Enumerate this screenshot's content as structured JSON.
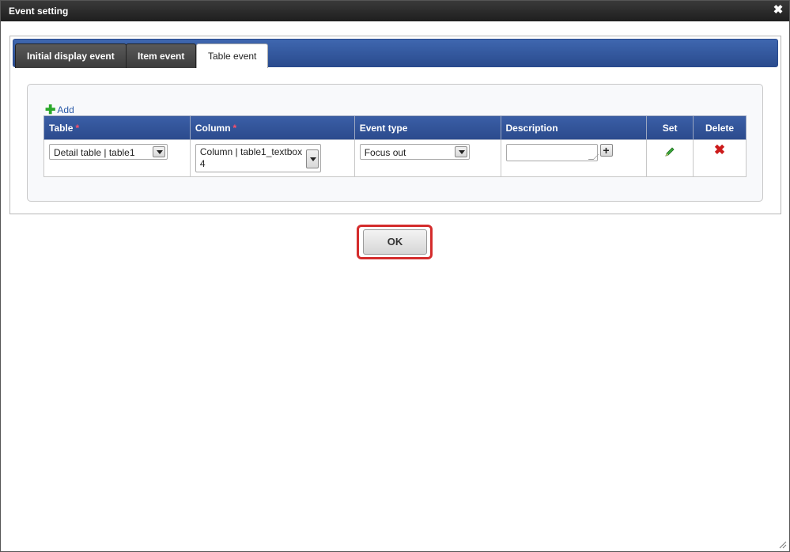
{
  "dialog": {
    "title": "Event setting",
    "close_icon": "close-icon"
  },
  "tabs": [
    {
      "label": "Initial display event",
      "active": false
    },
    {
      "label": "Item event",
      "active": false
    },
    {
      "label": "Table event",
      "active": true
    }
  ],
  "add_link": {
    "label": "Add",
    "icon": "plus-icon"
  },
  "table": {
    "headers": {
      "table": "Table",
      "column": "Column",
      "event_type": "Event type",
      "description": "Description",
      "set": "Set",
      "delete": "Delete"
    },
    "required_mark": "*",
    "rows": [
      {
        "table": "Detail table | table1",
        "column_line1": "Column | table1_textbox",
        "column_line2": "4",
        "event_type": "Focus out",
        "description": ""
      }
    ]
  },
  "ok_button": {
    "label": "OK"
  },
  "colors": {
    "title_bar": "#1e1e1e",
    "tab_bar": "#2a4b8e",
    "highlight": "#d42c2c",
    "delete": "#cc1a1a",
    "edit": "#2aa82a"
  }
}
